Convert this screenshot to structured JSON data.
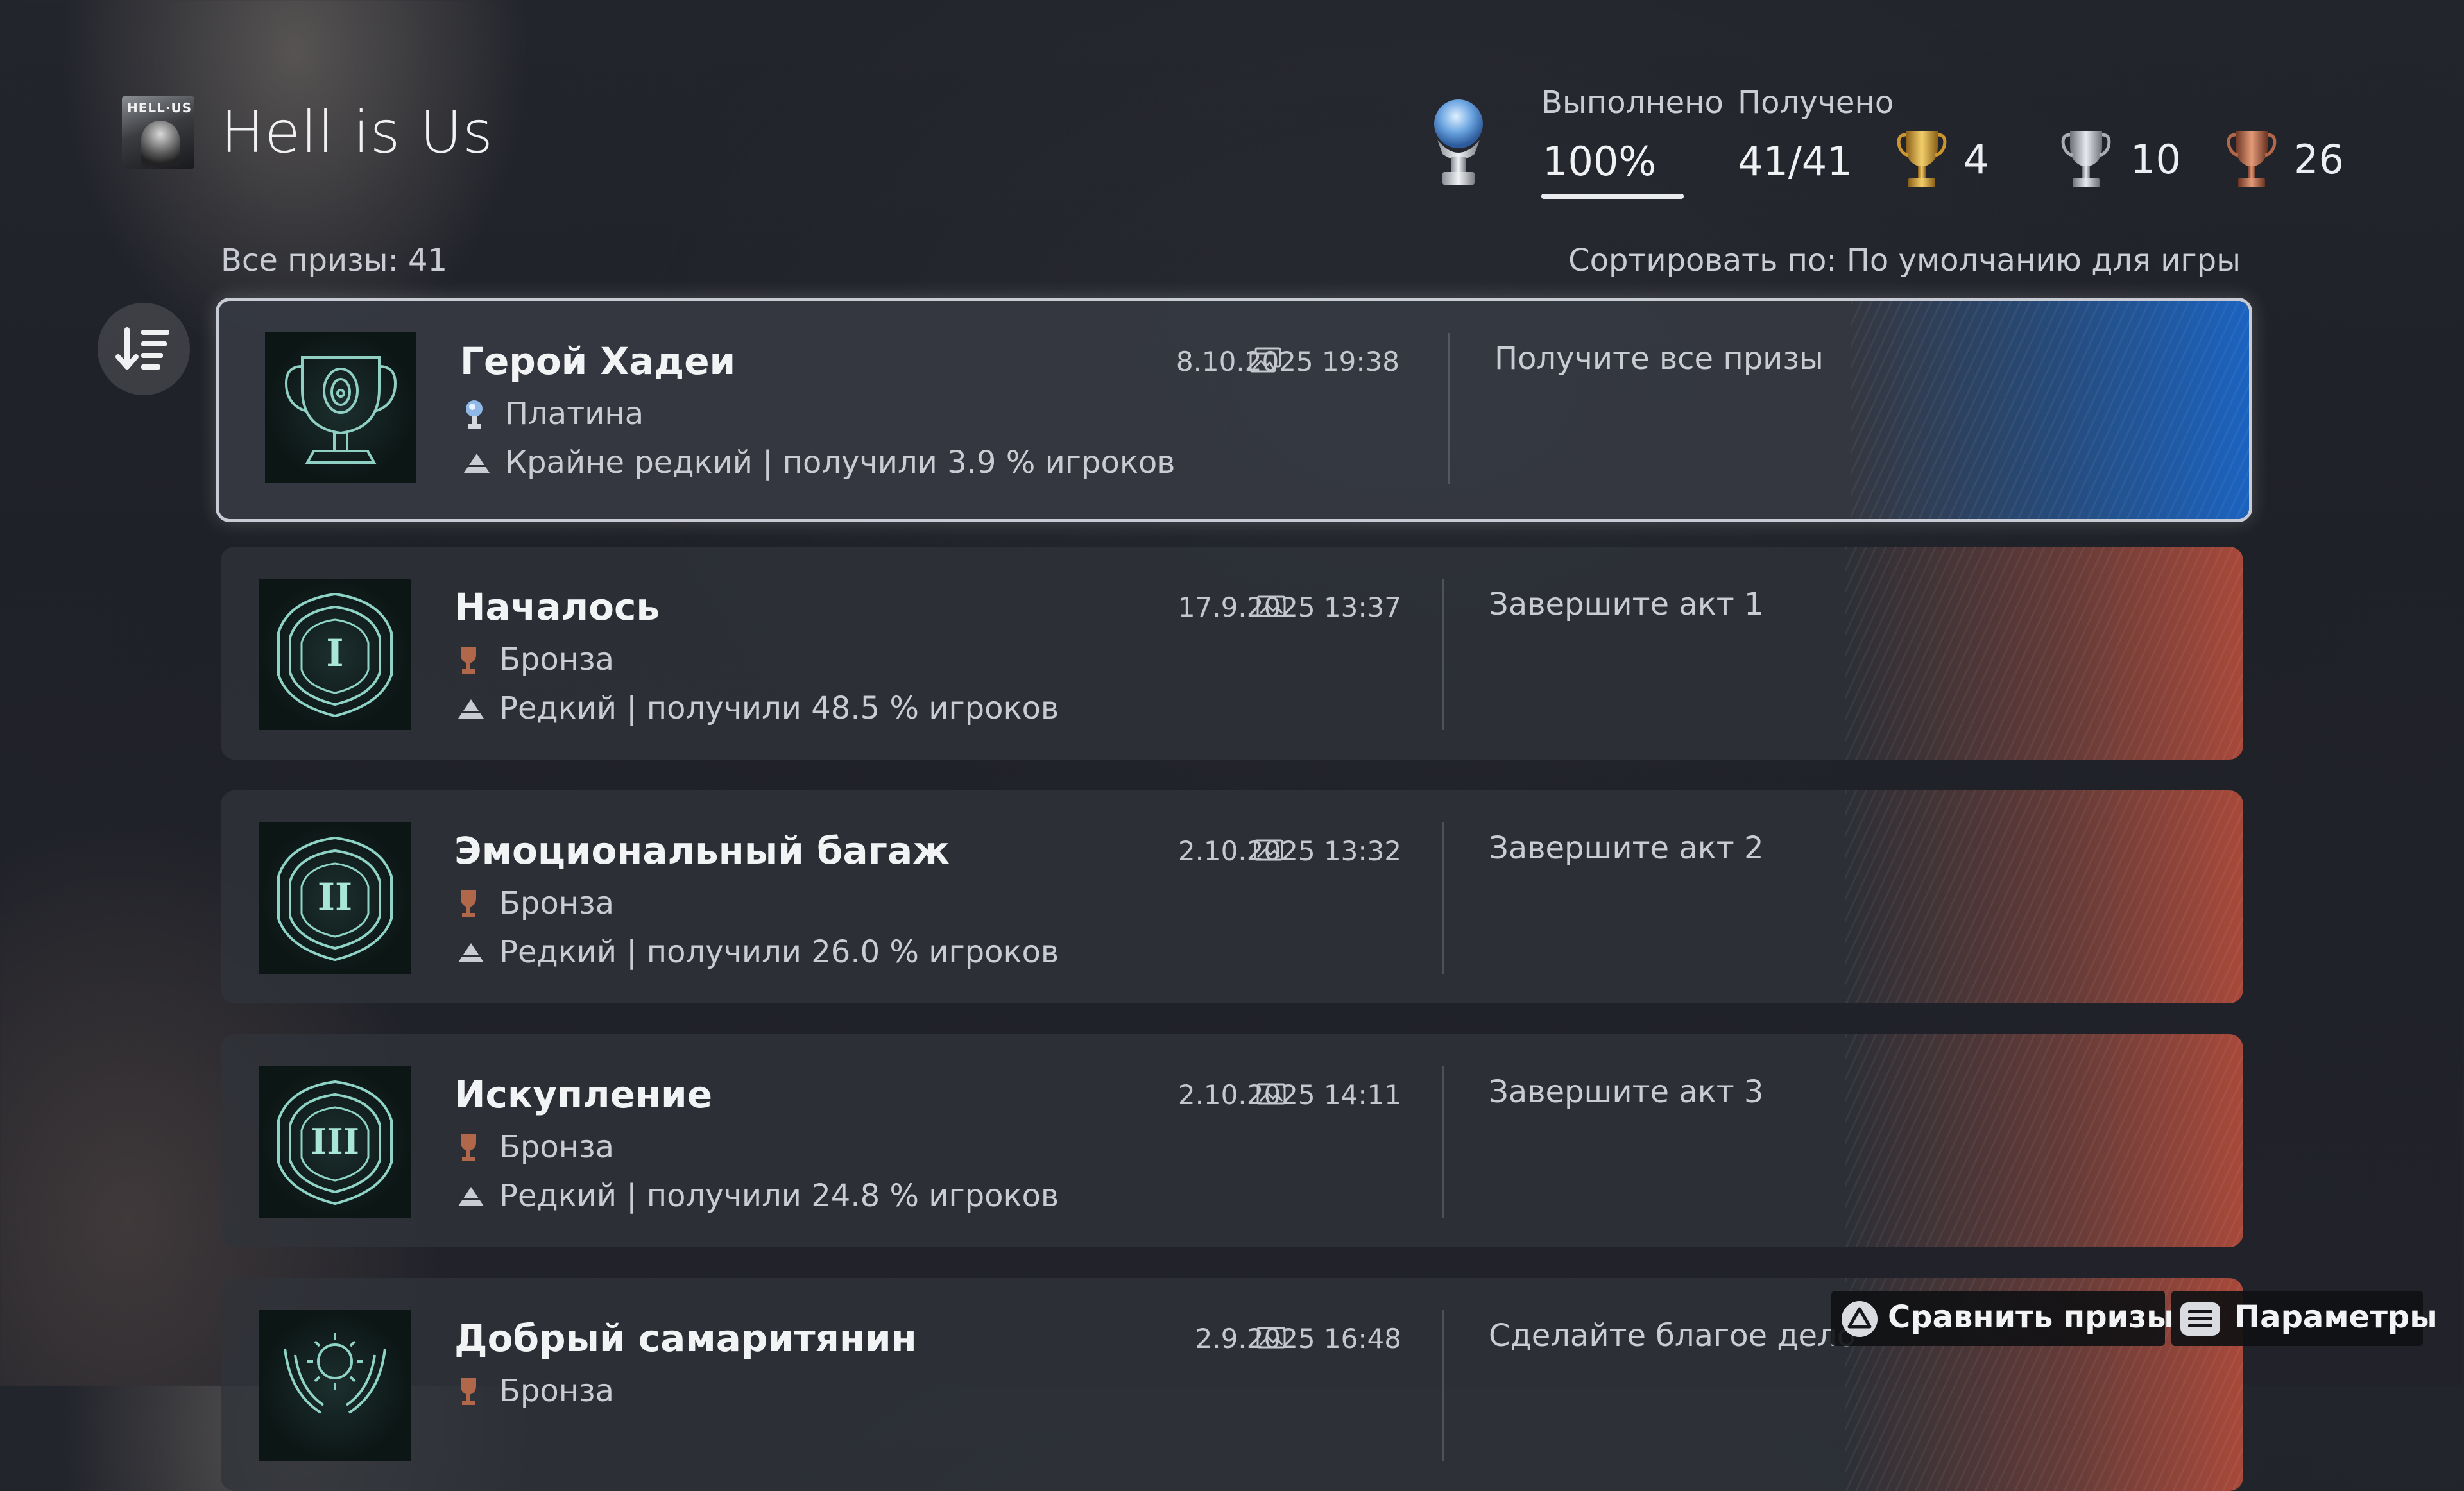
{
  "header": {
    "game_thumbnail_text": "HELL·US",
    "game_title": "Hell is Us",
    "completed_label": "Выполнено",
    "completed_value": "100%",
    "completed_progress": 1.0,
    "earned_label": "Получено",
    "earned_value": "41/41",
    "gold_count": "4",
    "silver_count": "10",
    "bronze_count": "26",
    "colors": {
      "gold": "#c9962f",
      "silver": "#a9adb4",
      "bronze": "#b0674a",
      "platinum": "#8fb8e6"
    }
  },
  "list": {
    "all_trophies_label": "Все призы: 41",
    "sort_label": "Сортировать по: По умолчанию для игры",
    "sort_icon": "sort-descending-icon"
  },
  "trophies": [
    {
      "name": "Герой Хадеи",
      "type": "Платина",
      "type_icon": "platinum-trophy-icon",
      "rarity": "Крайне редкий | получили 3.9 % игроков",
      "date": "8.10.2025  19:38",
      "description": "Получите все призы",
      "emblem": "trophy-cup-icon",
      "stripe_color": "#1b5aa8"
    },
    {
      "name": "Началось",
      "type": "Бронза",
      "type_icon": "bronze-trophy-icon",
      "rarity": "Редкий | получили 48.5 % игроков",
      "date": "17.9.2025  13:37",
      "description": "Завершите акт 1",
      "emblem": "I",
      "stripe_color": "#a8493a"
    },
    {
      "name": "Эмоциональный багаж",
      "type": "Бронза",
      "type_icon": "bronze-trophy-icon",
      "rarity": "Редкий | получили 26.0 % игроков",
      "date": "2.10.2025  13:32",
      "description": "Завершите акт 2",
      "emblem": "II",
      "stripe_color": "#a8493a"
    },
    {
      "name": "Искупление",
      "type": "Бронза",
      "type_icon": "bronze-trophy-icon",
      "rarity": "Редкий | получили 24.8 % игроков",
      "date": "2.10.2025  14:11",
      "description": "Завершите акт 3",
      "emblem": "III",
      "stripe_color": "#a8493a"
    },
    {
      "name": "Добрый самаритянин",
      "type": "Бронза",
      "type_icon": "bronze-trophy-icon",
      "rarity": "",
      "date": "2.9.2025  16:48",
      "description": "Сделайте благое дело",
      "emblem": "sun-hands-icon",
      "stripe_color": "#a8493a"
    }
  ],
  "footer": {
    "compare_label": "Сравнить призы",
    "compare_icon": "triangle-button-icon",
    "options_label": "Параметры",
    "options_icon": "options-button-icon"
  }
}
